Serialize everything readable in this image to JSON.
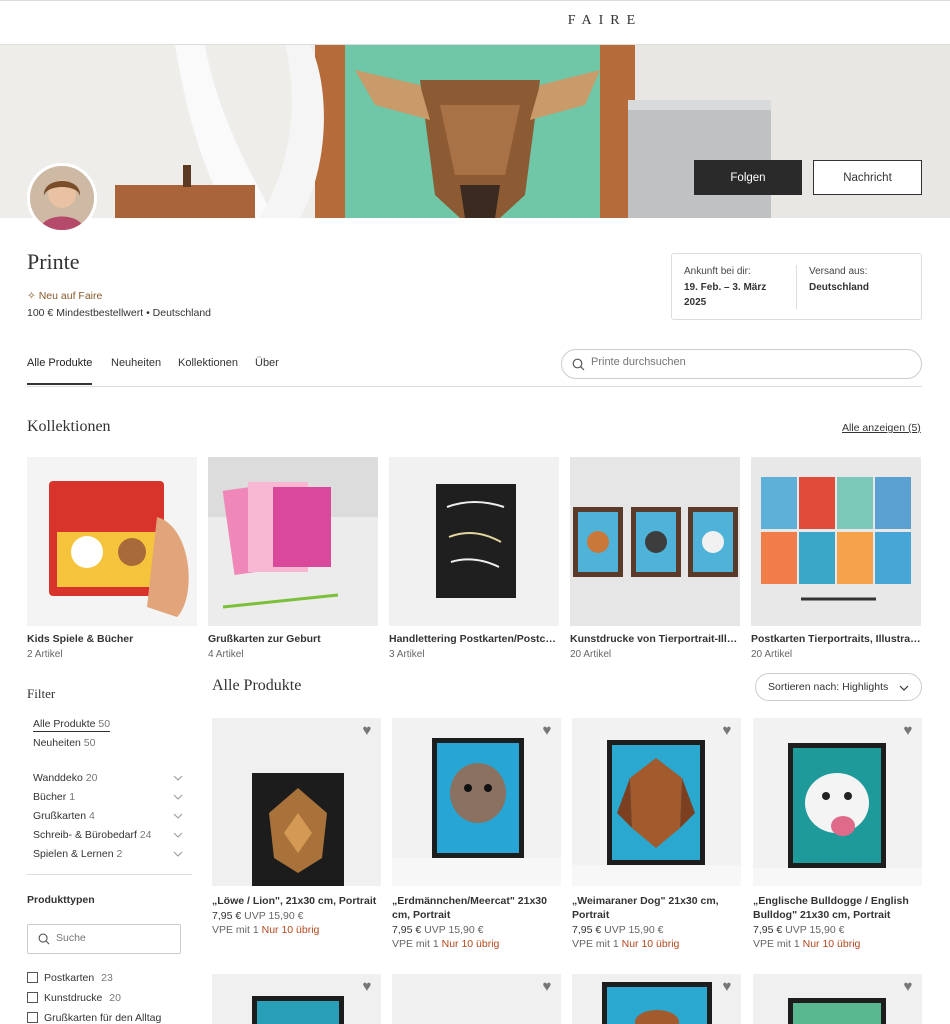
{
  "header": {
    "logo": "FAIRE"
  },
  "banner": {
    "follow_label": "Folgen",
    "message_label": "Nachricht"
  },
  "shop": {
    "name": "Printe",
    "new_tag": "Neu auf Faire",
    "min_order": "100 € Mindestbestellwert • Deutschland",
    "arrival_label": "Ankunft bei dir:",
    "arrival_value": "19. Feb. – 3. März 2025",
    "ships_label": "Versand aus:",
    "ships_value": "Deutschland"
  },
  "tabs": [
    {
      "label": "Alle Produkte",
      "active": true
    },
    {
      "label": "Neuheiten"
    },
    {
      "label": "Kollektionen"
    },
    {
      "label": "Über"
    }
  ],
  "search": {
    "placeholder": "Printe durchsuchen"
  },
  "collections": {
    "title": "Kollektionen",
    "show_all": "Alle anzeigen (5)",
    "items": [
      {
        "name": "Kids Spiele & Bücher",
        "count": "2 Artikel"
      },
      {
        "name": "Grußkarten zur Geburt",
        "count": "4 Artikel"
      },
      {
        "name": "Handlettering Postkarten/Postca...",
        "count": "3 Artikel"
      },
      {
        "name": "Kunstdrucke von Tierportrait-Illu...",
        "count": "20 Artikel"
      },
      {
        "name": "Postkarten Tierportraits, Illustrat...",
        "count": "20 Artikel"
      }
    ]
  },
  "filter": {
    "title": "Filter",
    "top": [
      {
        "label": "Alle Produkte",
        "count": "50"
      },
      {
        "label": "Neuheiten",
        "count": "50"
      }
    ],
    "categories": [
      {
        "label": "Wanddeko",
        "count": "20"
      },
      {
        "label": "Bücher",
        "count": "1"
      },
      {
        "label": "Grußkarten",
        "count": "4"
      },
      {
        "label": "Schreib- & Bürobedarf",
        "count": "24"
      },
      {
        "label": "Spielen & Lernen",
        "count": "2"
      }
    ],
    "product_types_title": "Produkttypen",
    "search_placeholder": "Suche",
    "product_types": [
      {
        "label": "Postkarten",
        "count": "23"
      },
      {
        "label": "Kunstdrucke",
        "count": "20"
      },
      {
        "label": "Grußkarten für den Alltag",
        "count": ""
      }
    ]
  },
  "products": {
    "title": "Alle Produkte",
    "sort_label": "Sortieren nach: Highlights",
    "items": [
      {
        "name": "„Löwe / Lion\", 21x30 cm, Portrait",
        "price": "7,95 €",
        "uvp": "UVP 15,90 €",
        "vpe": "VPE mit 1",
        "left": "Nur 10 übrig",
        "color": "#1d1d1d"
      },
      {
        "name": "„Erdmännchen/Meercat\" 21x30 cm, Portrait",
        "price": "7,95 €",
        "uvp": "UVP 15,90 €",
        "vpe": "VPE mit 1",
        "left": "Nur 10 übrig",
        "color": "#27a6d6"
      },
      {
        "name": "„Weimaraner Dog\" 21x30 cm, Portrait",
        "price": "7,95 €",
        "uvp": "UVP 15,90 €",
        "vpe": "VPE mit 1",
        "left": "Nur 10 übrig",
        "color": "#2aa8cf"
      },
      {
        "name": "„Englische Bulldogge / English Bulldog\" 21x30 cm, Portrait",
        "price": "7,95 €",
        "uvp": "UVP 15,90 €",
        "vpe": "VPE mit 1",
        "left": "Nur 10 übrig",
        "color": "#1f9a9a"
      }
    ]
  }
}
